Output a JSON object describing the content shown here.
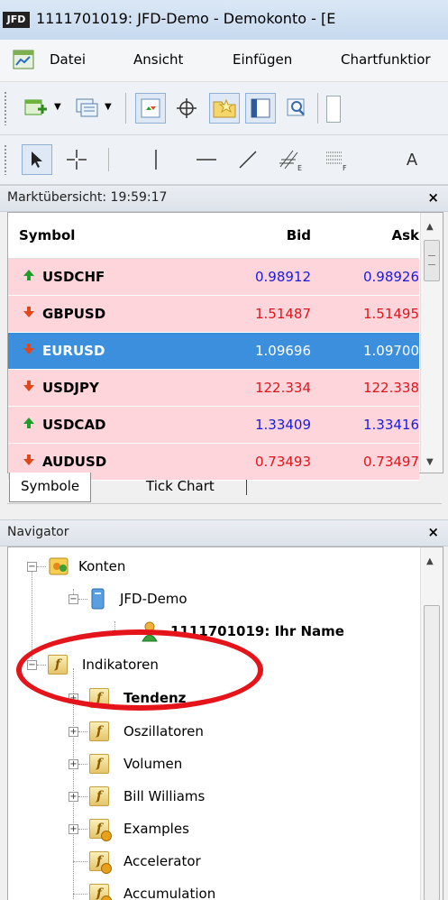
{
  "window": {
    "title": "1111701019: JFD-Demo - Demokonto - [E",
    "logo": "JFD"
  },
  "menu": [
    "Datei",
    "Ansicht",
    "Einfügen",
    "Chartfunktior"
  ],
  "toolbar2": {
    "text_tool": "A"
  },
  "market_watch": {
    "title": "Marktübersicht: 19:59:17",
    "close": "×",
    "columns": {
      "symbol": "Symbol",
      "bid": "Bid",
      "ask": "Ask"
    },
    "rows": [
      {
        "symbol": "USDCHF",
        "bid": "0.98912",
        "ask": "0.98926",
        "direction": "up",
        "price_color": "#1a1adf",
        "bg": "#ffd5dc"
      },
      {
        "symbol": "GBPUSD",
        "bid": "1.51487",
        "ask": "1.51495",
        "direction": "down",
        "price_color": "#e0151b",
        "bg": "#ffd5dc"
      },
      {
        "symbol": "EURUSD",
        "bid": "1.09696",
        "ask": "1.09700",
        "direction": "down",
        "price_color": "#ffffff",
        "bg": "#3c8fdc",
        "selected": true
      },
      {
        "symbol": "USDJPY",
        "bid": "122.334",
        "ask": "122.338",
        "direction": "down",
        "price_color": "#e0151b",
        "bg": "#ffd5dc"
      },
      {
        "symbol": "USDCAD",
        "bid": "1.33409",
        "ask": "1.33416",
        "direction": "up",
        "price_color": "#1a1adf",
        "bg": "#ffd5dc"
      },
      {
        "symbol": "AUDUSD",
        "bid": "0.73493",
        "ask": "0.73497",
        "direction": "down",
        "price_color": "#e0151b",
        "bg": "#ffd5dc"
      }
    ],
    "tabs": [
      "Symbole",
      "Tick Chart"
    ]
  },
  "navigator": {
    "title": "Navigator",
    "close": "×",
    "items": [
      {
        "label": "Konten",
        "icon": "accounts-icon"
      },
      {
        "label": "JFD-Demo",
        "icon": "server-icon"
      },
      {
        "label": "1111701019: Ihr Name",
        "icon": "user-account-icon"
      },
      {
        "label": "Indikatoren",
        "icon": "indicator-folder-icon"
      },
      {
        "label": "Tendenz",
        "icon": "indicator-folder-icon"
      },
      {
        "label": "Oszillatoren",
        "icon": "indicator-folder-icon"
      },
      {
        "label": "Volumen",
        "icon": "indicator-folder-icon"
      },
      {
        "label": "Bill Williams",
        "icon": "indicator-folder-icon"
      },
      {
        "label": "Examples",
        "icon": "custom-indicator-folder-icon"
      },
      {
        "label": "Accelerator",
        "icon": "custom-indicator-icon"
      },
      {
        "label": "Accumulation",
        "icon": "custom-indicator-icon"
      }
    ]
  },
  "colors": {
    "highlight_circle": "#e5141b",
    "selection": "#3c8fdc",
    "up_arrow": "#1e9e2a",
    "down_arrow": "#e0481b"
  }
}
